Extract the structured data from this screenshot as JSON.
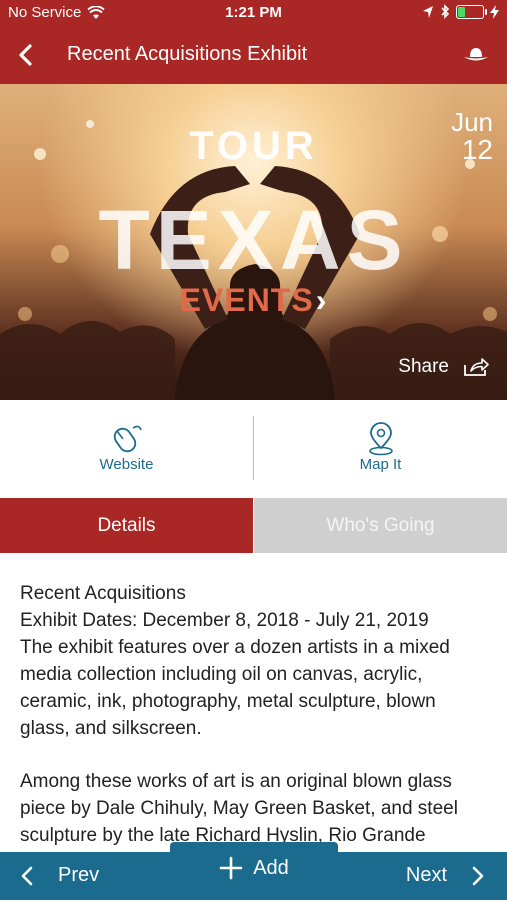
{
  "status_bar": {
    "carrier": "No Service",
    "time": "1:21 PM",
    "icons": [
      "wifi-icon",
      "location-icon",
      "bluetooth-icon",
      "battery-icon",
      "charging-icon"
    ]
  },
  "nav": {
    "title": "Recent Acquisitions Exhibit",
    "back_icon": "chevron-left-icon",
    "hat_icon": "cowboy-hat-icon"
  },
  "hero": {
    "brand": {
      "line1": "TOUR",
      "line2": "TEXAS",
      "line3": "EVENTS",
      "chevron": "›"
    },
    "date": {
      "month": "Jun",
      "day": "12"
    },
    "share_label": "Share",
    "share_icon": "share-icon"
  },
  "actions": [
    {
      "label": "Website",
      "icon": "mouse-icon"
    },
    {
      "label": "Map It",
      "icon": "map-pin-icon"
    }
  ],
  "tabs": [
    {
      "label": "Details",
      "active": true
    },
    {
      "label": "Who's Going",
      "active": false
    }
  ],
  "details": {
    "heading": "Recent Acquisitions",
    "dates": "Exhibit Dates: December 8, 2018 - July 21, 2019",
    "para1": "The exhibit features over a dozen artists in a mixed media collection including oil on canvas, acrylic, ceramic, ink, photography, metal sculpture, blown glass, and silkscreen.",
    "para2": "Among these works of art is an original blown glass piece by Dale Chihuly, May Green Basket, and steel sculpture by the late Richard Hyslin, Rio Grande Valley..."
  },
  "bottom": {
    "prev": "Prev",
    "add": "Add",
    "next": "Next"
  },
  "colors": {
    "brand_red": "#a92724",
    "brand_blue": "#1b6b8f",
    "tab_inactive": "#cfcfcf"
  }
}
